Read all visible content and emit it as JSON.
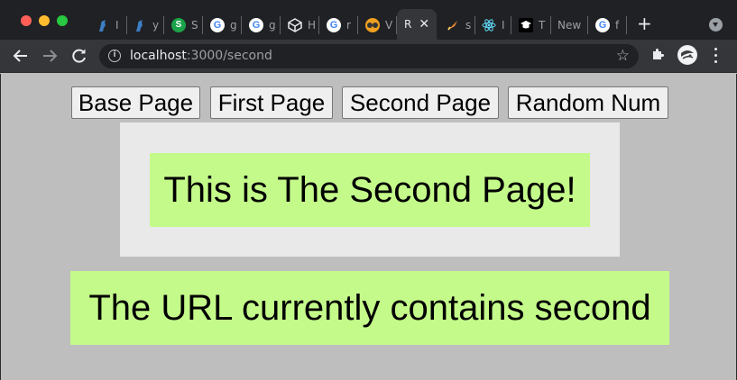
{
  "browser": {
    "tabs": [
      {
        "title": "I",
        "icon": "bird-icon",
        "color": "#3d7ec4",
        "glyph": ""
      },
      {
        "title": "y",
        "icon": "bird-icon",
        "color": "#3d7ec4",
        "glyph": ""
      },
      {
        "title": "S",
        "icon": "s-logo-icon",
        "color": "#1aa34a",
        "glyph": "S"
      },
      {
        "title": "g",
        "icon": "google-icon",
        "color": "#ffffff",
        "glyph": "G"
      },
      {
        "title": "g",
        "icon": "google-icon",
        "color": "#ffffff",
        "glyph": "G"
      },
      {
        "title": "H",
        "icon": "cube-icon",
        "color": "#cfcfcf",
        "glyph": ""
      },
      {
        "title": "r",
        "icon": "google-icon",
        "color": "#ffffff",
        "glyph": "G"
      },
      {
        "title": "V",
        "icon": "goggles-icon",
        "color": "#f0a020",
        "glyph": ""
      },
      {
        "title": "s",
        "icon": "rocket-icon",
        "color": "#f28b30",
        "glyph": ""
      },
      {
        "title": "I",
        "icon": "react-icon",
        "color": "#61dafb",
        "glyph": ""
      },
      {
        "title": "T",
        "icon": "graduation-cap-icon",
        "color": "#000000",
        "glyph": ""
      }
    ],
    "active_tab": {
      "title": "R"
    },
    "new_tab": {
      "title": "New"
    },
    "last_tab": {
      "title": "f"
    },
    "url_host": "localhost",
    "url_path": ":3000/second"
  },
  "nav": {
    "base": "Base Page",
    "first": "First Page",
    "second": "Second Page",
    "random": "Random Num"
  },
  "content": {
    "heading": "This is The Second Page!",
    "url_message": "The URL currently contains second"
  }
}
